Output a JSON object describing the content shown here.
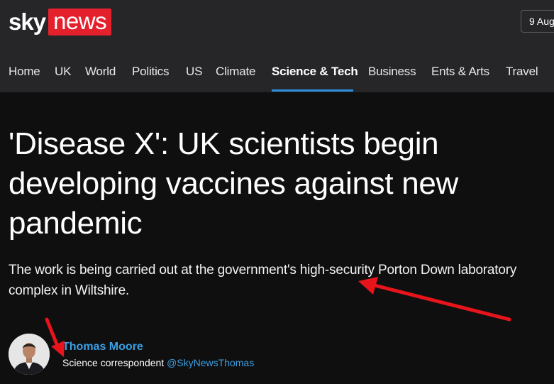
{
  "brand": {
    "sky": "sky",
    "news": "news",
    "accent": "#e5202d"
  },
  "header": {
    "date": "9 Aug"
  },
  "nav": {
    "items": [
      {
        "label": "Home"
      },
      {
        "label": "UK"
      },
      {
        "label": "World"
      },
      {
        "label": "Politics"
      },
      {
        "label": "US"
      },
      {
        "label": "Climate"
      },
      {
        "label": "Science & Tech",
        "active": true
      },
      {
        "label": "Business"
      },
      {
        "label": "Ents & Arts"
      },
      {
        "label": "Travel"
      }
    ],
    "active_color": "#2d8fdc"
  },
  "article": {
    "headline": "'Disease X': UK scientists begin developing vaccines against new pandemic",
    "standfirst": "The work is being carried out at the government's high-security Porton Down laboratory complex in Wiltshire."
  },
  "author": {
    "name": "Thomas Moore",
    "role": "Science correspondent",
    "handle": "@SkyNewsThomas",
    "link_color": "#3b9fe3"
  },
  "annotations": {
    "arrow_color": "#e8141c",
    "icon": "red-arrow-icon"
  }
}
